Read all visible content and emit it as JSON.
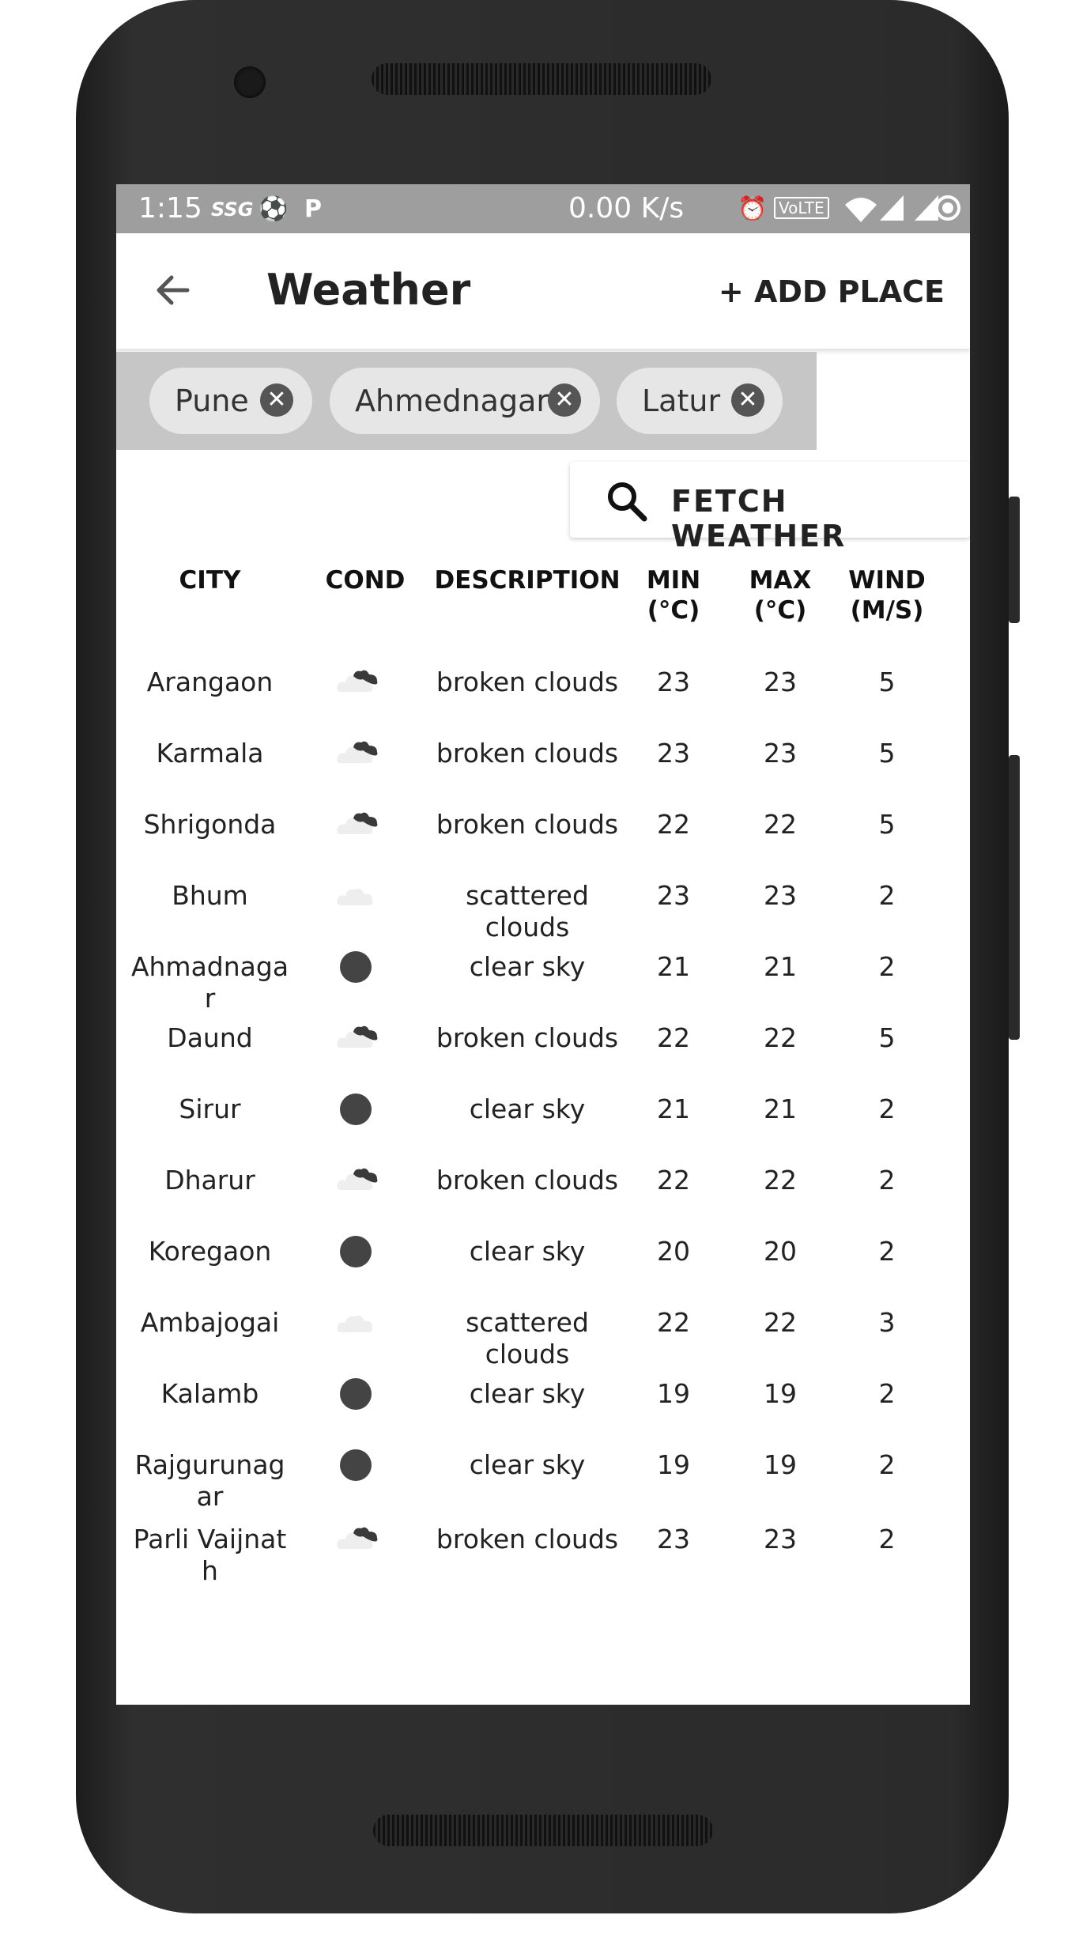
{
  "status_bar": {
    "time": "1:15",
    "icon1": "SSG",
    "speed": "0.00 K/s",
    "volte": "VoLTE"
  },
  "app_bar": {
    "title": "Weather",
    "add_place": "+ ADD PLACE"
  },
  "chips": [
    {
      "label": "Pune"
    },
    {
      "label": "Ahmednagar"
    },
    {
      "label": "Latur"
    }
  ],
  "fetch_button": {
    "label": "FETCH WEATHER"
  },
  "table": {
    "headers": {
      "city": "CITY",
      "cond": "COND",
      "description": "DESCRIPTION",
      "min": "MIN\n(°C)",
      "max": "MAX\n(°C)",
      "wind": "WIND\n(M/S)"
    },
    "rows": [
      {
        "city": "Arangaon",
        "cond": "broken-clouds-icon",
        "description": "broken clouds",
        "min": "23",
        "max": "23",
        "wind": "5"
      },
      {
        "city": "Karmala",
        "cond": "broken-clouds-icon",
        "description": "broken clouds",
        "min": "23",
        "max": "23",
        "wind": "5"
      },
      {
        "city": "Shrigonda",
        "cond": "broken-clouds-icon",
        "description": "broken clouds",
        "min": "22",
        "max": "22",
        "wind": "5"
      },
      {
        "city": "Bhum",
        "cond": "scattered-clouds-icon",
        "description": "scattered clouds",
        "min": "23",
        "max": "23",
        "wind": "2"
      },
      {
        "city": "Ahmadnagar",
        "cond": "clear-sky-icon",
        "description": "clear sky",
        "min": "21",
        "max": "21",
        "wind": "2"
      },
      {
        "city": "Daund",
        "cond": "broken-clouds-icon",
        "description": "broken clouds",
        "min": "22",
        "max": "22",
        "wind": "5"
      },
      {
        "city": "Sirur",
        "cond": "clear-sky-icon",
        "description": "clear sky",
        "min": "21",
        "max": "21",
        "wind": "2"
      },
      {
        "city": "Dharur",
        "cond": "broken-clouds-icon",
        "description": "broken clouds",
        "min": "22",
        "max": "22",
        "wind": "2"
      },
      {
        "city": "Koregaon",
        "cond": "clear-sky-icon",
        "description": "clear sky",
        "min": "20",
        "max": "20",
        "wind": "2"
      },
      {
        "city": "Ambajogai",
        "cond": "scattered-clouds-icon",
        "description": "scattered clouds",
        "min": "22",
        "max": "22",
        "wind": "3"
      },
      {
        "city": "Kalamb",
        "cond": "clear-sky-icon",
        "description": "clear sky",
        "min": "19",
        "max": "19",
        "wind": "2"
      },
      {
        "city": "Rajgurunagar",
        "cond": "clear-sky-icon",
        "description": "clear sky",
        "min": "19",
        "max": "19",
        "wind": "2"
      },
      {
        "city": "Parli Vaijnath",
        "cond": "broken-clouds-icon",
        "description": "broken clouds",
        "min": "23",
        "max": "23",
        "wind": "2"
      }
    ]
  },
  "colors": {
    "status_bar": "#9e9e9e",
    "chip_area": "#c6c6c6",
    "chip": "#e6e6e6",
    "phone_body": "#2b2b2b"
  }
}
